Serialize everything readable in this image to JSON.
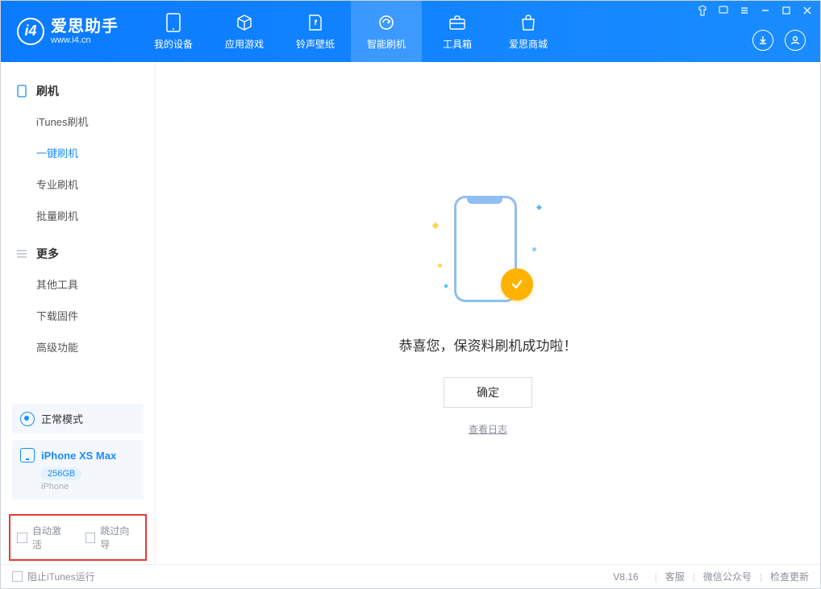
{
  "header": {
    "app_title": "爱思助手",
    "app_sub": "www.i4.cn",
    "nav": [
      {
        "label": "我的设备"
      },
      {
        "label": "应用游戏"
      },
      {
        "label": "铃声壁纸"
      },
      {
        "label": "智能刷机"
      },
      {
        "label": "工具箱"
      },
      {
        "label": "爱思商城"
      }
    ]
  },
  "sidebar": {
    "group1_title": "刷机",
    "group1_items": [
      "iTunes刷机",
      "一键刷机",
      "专业刷机",
      "批量刷机"
    ],
    "group2_title": "更多",
    "group2_items": [
      "其他工具",
      "下载固件",
      "高级功能"
    ],
    "mode_label": "正常模式",
    "device": {
      "name": "iPhone XS Max",
      "storage": "256GB",
      "type": "iPhone"
    },
    "options": {
      "auto_activate": "自动激活",
      "skip_guide": "跳过向导"
    }
  },
  "main": {
    "success_msg": "恭喜您，保资料刷机成功啦！",
    "ok_button": "确定",
    "view_log": "查看日志"
  },
  "footer": {
    "block_itunes": "阻止iTunes运行",
    "version": "V8.16",
    "links": [
      "客服",
      "微信公众号",
      "检查更新"
    ]
  }
}
